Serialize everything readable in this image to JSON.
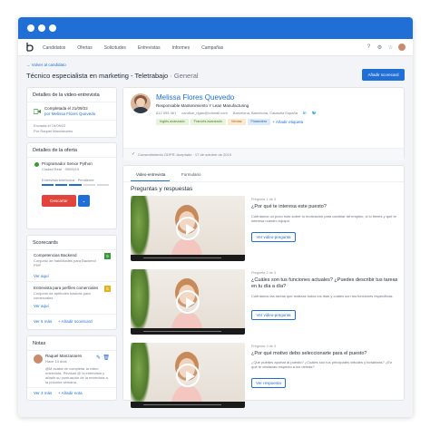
{
  "nav": {
    "items": [
      "Candidatos",
      "Ofertas",
      "Solicitudes",
      "Entrevistas",
      "Informes",
      "Campañas"
    ]
  },
  "page": {
    "back_link": "Volver al candidato",
    "title": "Técnico especialista en marketing - Teletrabajo",
    "title_suffix": " · General",
    "scorecard_button": "Añadir scorecard"
  },
  "interview_details": {
    "heading": "Detalles de la video-entrevista",
    "status": "Completada el 21/09/22",
    "by": "por Melissa Flores Quevedo",
    "created": "Enviada el 19/09/22",
    "creator": "Por Raquel Manzanares"
  },
  "offer_details": {
    "heading": "Detalles de la oferta",
    "offer_name": "Programador Senior Python",
    "location": "Ciudad Real · 09/09/19",
    "stage": "Entrevista telefónica · Pendiente",
    "discard_button": "Descartar"
  },
  "scorecards": {
    "heading": "Scorecards",
    "items": [
      {
        "title": "Competencias Backend",
        "desc": "Conjunto de habilidades para Backend PHP",
        "score": "5",
        "link": "Ver aquí"
      },
      {
        "title": "Entrevista para perfiles comerciales",
        "desc": "Conjunto de aptitudes básicas para comerciales",
        "score": "5",
        "link": "Ver aquí"
      }
    ],
    "see_all": "Ver 5 más",
    "add": "+ Añadir scorecard"
  },
  "notes": {
    "heading": "Notas",
    "author": "Raquel Manzanares",
    "when": "Hace 14 días",
    "text": "@M acaba de completar la video entrevista. Revisad @ la entrevista y añadir su puntuación de la entrevista a la próxima semana.",
    "see_more": "Ver 3 más",
    "add": "+ Añadir nota"
  },
  "candidate": {
    "name": "Melissa Flores Quevedo",
    "role": "Responsable Mantenimiento Y Lean Manufacturing",
    "phone": "612 095 461",
    "email": "candice_rigan@hotmail.com",
    "location": "Barcelona, Barcelona, Cataluña España",
    "tags": [
      {
        "label": "Inglés avanzado",
        "color": "#e7f3dc",
        "text": "#4d7a24"
      },
      {
        "label": "Francés avanzado",
        "color": "#e7f3dc",
        "text": "#4d7a24"
      },
      {
        "label": "Ventas",
        "color": "#fde9cf",
        "text": "#a7621b"
      },
      {
        "label": "Financiero",
        "color": "#dcebfa",
        "text": "#2a5e9c"
      }
    ],
    "add_tag": "+ Añadir etiqueta",
    "gdpr": "Consentimiento GDPR: Aceptado · 17 de octubre de 2019"
  },
  "tabs": [
    "Video-entrevista",
    "Formulario"
  ],
  "questions_heading": "Preguntas y respuestas",
  "questions": [
    {
      "label": "Pregunta 1 de 3",
      "text": "¿Por qué te interesa este puesto?",
      "sub": "Cuéntanos un poco más sobre tu motivación para cambiar de empleo, si lo tienes y qué te interesa nuestro equipo.",
      "button": "Ver video-pregunta"
    },
    {
      "label": "Pregunta 2 de 3",
      "text": "¿Cuáles son tus funciones actuales? ¿Puedes describir tus tareas en tu día a día?",
      "sub": "Cuéntanos las tareas que realizas todos los días y cuáles son tus funciones específicas.",
      "button": "Ver video-pregunta"
    },
    {
      "label": "Pregunta 3 de 3",
      "text": "¿Por qué motivo debo seleccionarte para el puesto?",
      "sub": "¿Qué puedes aportar al puesto? ¿Cuáles son tus principales virtudes y fortalezas? ¿En qué te destacas respecto a los demás?",
      "button": "Ver respuesta"
    }
  ]
}
